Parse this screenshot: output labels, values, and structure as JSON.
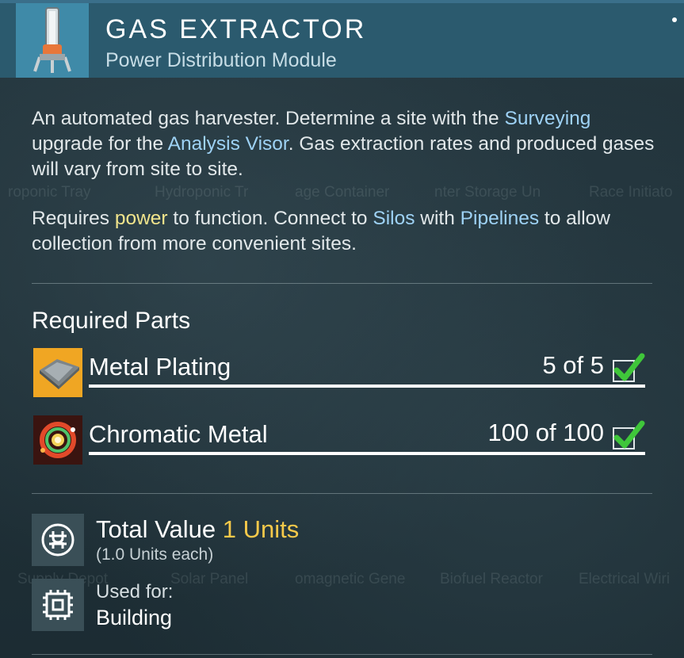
{
  "header": {
    "title": "GAS EXTRACTOR",
    "subtitle": "Power Distribution Module",
    "icon": "gas-extractor-icon"
  },
  "description": {
    "p1": [
      {
        "text": "An automated gas harvester. Determine a site with the ",
        "style": "plain"
      },
      {
        "text": "Surveying",
        "style": "blue"
      },
      {
        "text": " upgrade for the ",
        "style": "plain"
      },
      {
        "text": "Analysis Visor",
        "style": "blue"
      },
      {
        "text": ". Gas extraction rates and produced gases will vary from site to site.",
        "style": "plain"
      }
    ],
    "p2": [
      {
        "text": "Requires ",
        "style": "plain"
      },
      {
        "text": "power",
        "style": "yellow"
      },
      {
        "text": " to function. Connect to ",
        "style": "plain"
      },
      {
        "text": "Silos",
        "style": "blue"
      },
      {
        "text": " with ",
        "style": "plain"
      },
      {
        "text": "Pipelines",
        "style": "blue"
      },
      {
        "text": " to allow collection from more convenient sites.",
        "style": "plain"
      }
    ]
  },
  "background_labels": [
    "roponic Tray",
    "Hydroponic Tr",
    "age Container",
    "nter Storage Un",
    "Race Initiato",
    "Supply Depot",
    "Solar Panel",
    "omagnetic Gene",
    "Biofuel Reactor",
    "Electrical Wiri"
  ],
  "required_parts": {
    "title": "Required Parts",
    "items": [
      {
        "name": "Metal Plating",
        "count": "5 of 5",
        "icon": "metal-plating-icon",
        "complete": true
      },
      {
        "name": "Chromatic Metal",
        "count": "100 of 100",
        "icon": "chromatic-metal-icon",
        "complete": true
      }
    ]
  },
  "total_value": {
    "label": "Total Value",
    "units": "1 Units",
    "each": "(1.0 Units each)",
    "icon": "units-icon"
  },
  "used_for": {
    "label": "Used for:",
    "value": "Building",
    "icon": "chip-icon"
  },
  "colors": {
    "accent_blue": "#9ed2f5",
    "accent_yellow": "#f2e58c",
    "units_yellow": "#f6c94a",
    "check_green": "#3fc63a",
    "header_bg": "#2b5a6e"
  }
}
